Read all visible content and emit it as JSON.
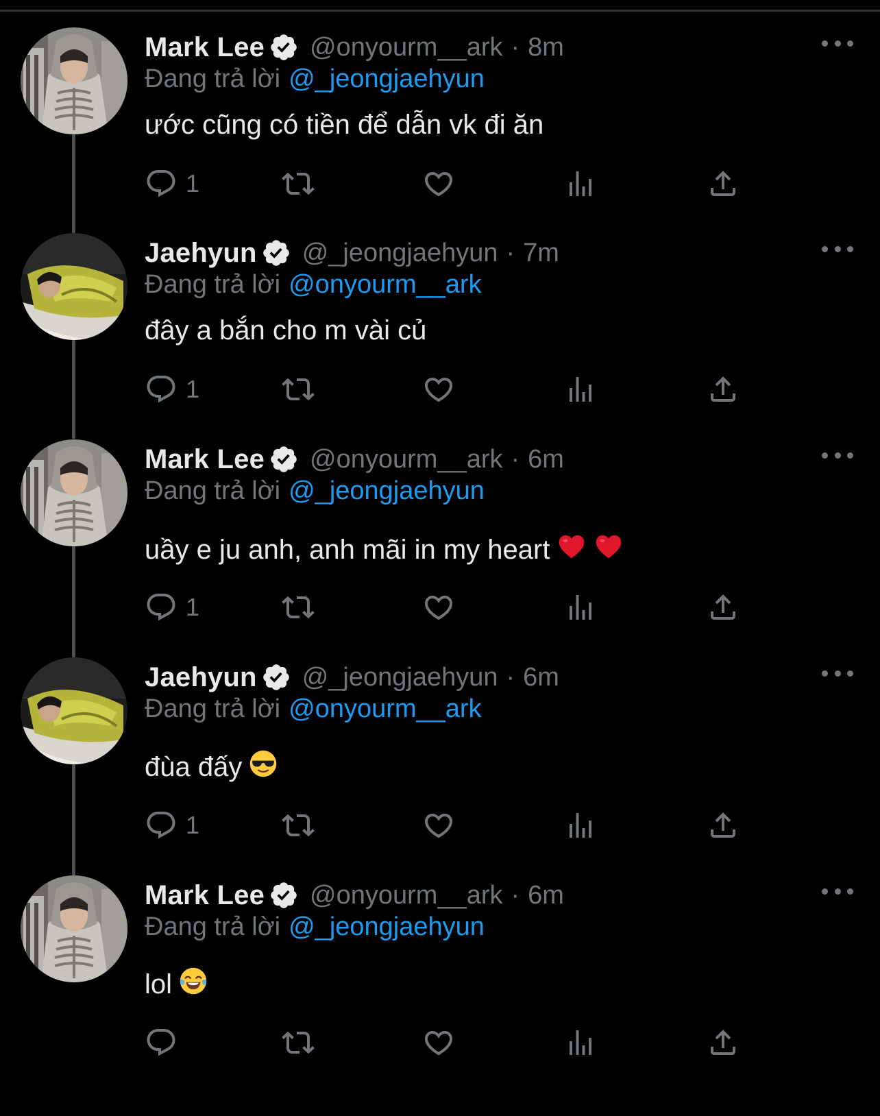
{
  "tweets": [
    {
      "name": "Mark Lee",
      "handle": "@onyourm__ark",
      "separator": "·",
      "time": "8m",
      "reply_prefix": "Đang trả lời",
      "reply_to": "@_jeongjaehyun",
      "text": "ước cũng có tiền để dẫn vk đi ăn",
      "reply_count": "1",
      "avatar": "avatar-mark-lee"
    },
    {
      "name": "Jaehyun",
      "handle": "@_jeongjaehyun",
      "separator": "·",
      "time": "7m",
      "reply_prefix": "Đang trả lời",
      "reply_to": "@onyourm__ark",
      "text": "đây a bắn cho m vài củ",
      "reply_count": "1",
      "avatar": "avatar-jaehyun"
    },
    {
      "name": "Mark Lee",
      "handle": "@onyourm__ark",
      "separator": "·",
      "time": "6m",
      "reply_prefix": "Đang trả lời",
      "reply_to": "@_jeongjaehyun",
      "text": "uầy e ju anh, anh mãi in my heart",
      "emojis": [
        "red-heart-emoji",
        "red-heart-emoji"
      ],
      "reply_count": "1",
      "avatar": "avatar-mark-lee"
    },
    {
      "name": "Jaehyun",
      "handle": "@_jeongjaehyun",
      "separator": "·",
      "time": "6m",
      "reply_prefix": "Đang trả lời",
      "reply_to": "@onyourm__ark",
      "text": "đùa đấy",
      "emojis": [
        "sunglasses-emoji"
      ],
      "reply_count": "1",
      "avatar": "avatar-jaehyun"
    },
    {
      "name": "Mark Lee",
      "handle": "@onyourm__ark",
      "separator": "·",
      "time": "6m",
      "reply_prefix": "Đang trả lời",
      "reply_to": "@_jeongjaehyun",
      "text": "lol",
      "emojis": [
        "tears-of-joy-emoji"
      ],
      "reply_count": "",
      "avatar": "avatar-mark-lee"
    }
  ],
  "icons": {
    "verified": "verified-badge-icon",
    "more": "more-options-icon",
    "reply": "reply-icon",
    "retweet": "retweet-icon",
    "like": "like-icon",
    "views": "views-icon",
    "share": "share-icon"
  },
  "colors": {
    "background": "#000000",
    "text_primary": "#e7e9ea",
    "text_secondary": "#71767b",
    "accent": "#1d9bf0",
    "thread_line": "#4a4f54"
  }
}
